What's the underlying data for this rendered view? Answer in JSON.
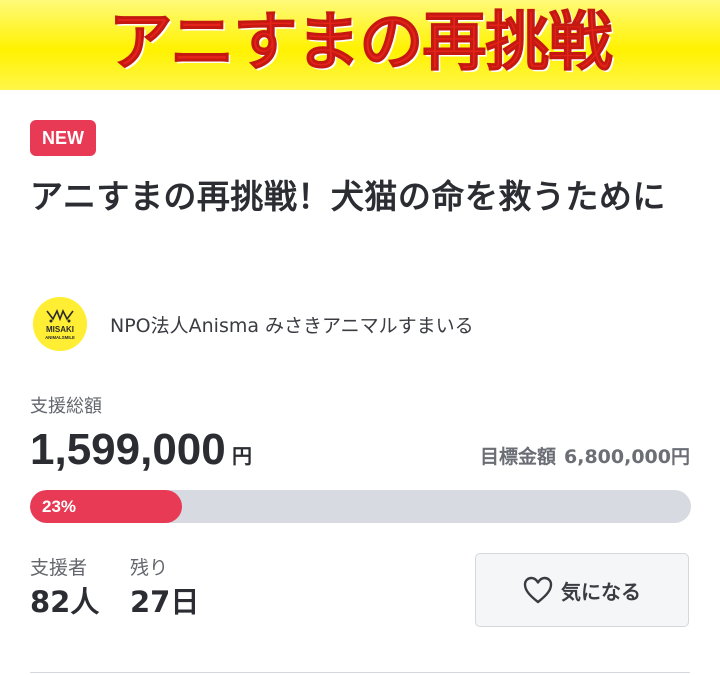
{
  "banner": {
    "title": "アニすまの再挑戦"
  },
  "project": {
    "badge": "NEW",
    "title": "アニすまの再挑戦！犬猫の命を救うために"
  },
  "organization": {
    "name": "NPO法人Anisma みさきアニマルすまいる",
    "logo_icon": "misaki-animal-smile-logo",
    "logo_text_top": "MISAKI",
    "logo_text_bottom": "ANIMALSMILE"
  },
  "funding": {
    "amount_label": "支援総額",
    "amount_value": "1,599,000",
    "amount_unit": "円",
    "goal_label": "目標金額",
    "goal_value": "6,800,000円",
    "progress_percent": 23,
    "progress_text": "23%"
  },
  "stats": {
    "supporters_label": "支援者",
    "supporters_value": "82人",
    "remaining_label": "残り",
    "remaining_value": "27日"
  },
  "actions": {
    "watch_label": "気になる",
    "watch_icon": "heart-icon"
  },
  "colors": {
    "accent": "#e93a55",
    "banner_bg": "#fff200",
    "banner_text": "#e4231b",
    "track": "#d7dae0"
  }
}
